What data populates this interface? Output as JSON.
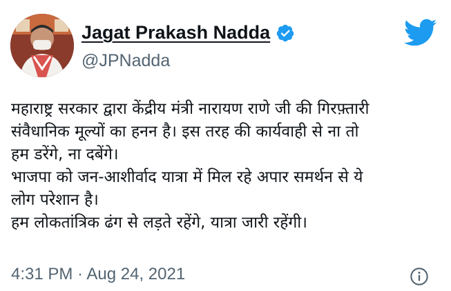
{
  "author": {
    "display_name": "Jagat Prakash Nadda",
    "handle": "@JPNadda",
    "verified": true
  },
  "tweet": {
    "lines": [
      "महाराष्ट्र सरकार द्वारा केंद्रीय मंत्री नारायण राणे जी की गिरफ़्तारी",
      "संवैधानिक मूल्यों का हनन है। इस तरह की कार्यवाही से ना तो",
      "हम डरेंगे, ना दबेंगे।",
      "भाजपा को जन-आशीर्वाद यात्रा में मिल रहे अपार समर्थन से ये",
      "लोग परेशान है।",
      "हम लोकतांत्रिक ढंग से लड़ते रहेंगे, यात्रा जारी रहेंगी।"
    ]
  },
  "meta": {
    "time": "4:31 PM",
    "separator": " · ",
    "date": "Aug 24, 2021"
  },
  "icons": {
    "verified": "verified-badge-icon",
    "brand": "twitter-bird-icon",
    "info": "info-icon"
  },
  "colors": {
    "twitter_blue": "#1d9bf0",
    "text_primary": "#0f1419",
    "text_secondary": "#536471"
  }
}
